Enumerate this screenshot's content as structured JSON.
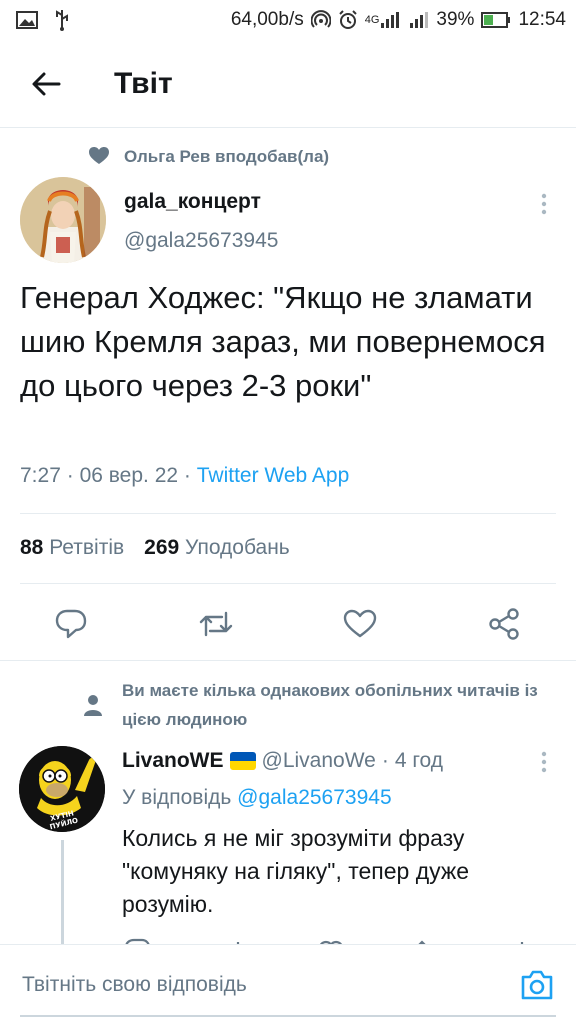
{
  "status_bar": {
    "net_speed": "64,00b/s",
    "network": "4G",
    "battery": "39%",
    "time": "12:54",
    "icons": [
      "image-icon",
      "usb-icon",
      "hotspot-icon",
      "alarm-icon",
      "signal-icon",
      "battery-icon"
    ]
  },
  "header": {
    "title": "Твіт",
    "back_icon": "arrow-left-icon"
  },
  "social_context": {
    "text": "Ольга Рев вподобав(ла)",
    "icon": "heart-filled-icon"
  },
  "tweet": {
    "name": "gala_концерт",
    "handle": "@gala25673945",
    "text": "Генерал Ходжес: \"Якщо не зламати шию Кремля зараз, ми повернемося до цього через 2-3 роки\"",
    "time": "7:27",
    "date": "06 вер. 22",
    "separator": "·",
    "source": "Twitter Web App",
    "retweets_count": "88",
    "retweets_label": "Ретвітів",
    "likes_count": "269",
    "likes_label": "Уподобань",
    "actions": [
      "reply-icon",
      "retweet-icon",
      "like-icon",
      "share-icon"
    ]
  },
  "reply_context": {
    "text": "Ви маєте кілька однакових обопільних читачів із цією людиною",
    "icon": "person-icon"
  },
  "reply": {
    "name": "LivanoWE",
    "flag_colors": [
      "#0057b7",
      "#ffd700"
    ],
    "handle": "@LivanoWe",
    "separator": "·",
    "time": "4 год",
    "reply_to_label": "У відповідь",
    "reply_to_handle": "@gala25673945",
    "text": "Колись я не міг зрозуміти фразу \"комуняку на гіляку\", тепер дуже розумію.",
    "avatar_badge": "ХУТІН ПУЙЛО"
  },
  "compose": {
    "placeholder": "Твітніть свою відповідь",
    "icon": "camera-icon"
  },
  "colors": {
    "accent": "#1da1f2",
    "secondary_text": "#657786",
    "primary_text": "#14171a",
    "divider": "#e6ecf0"
  }
}
